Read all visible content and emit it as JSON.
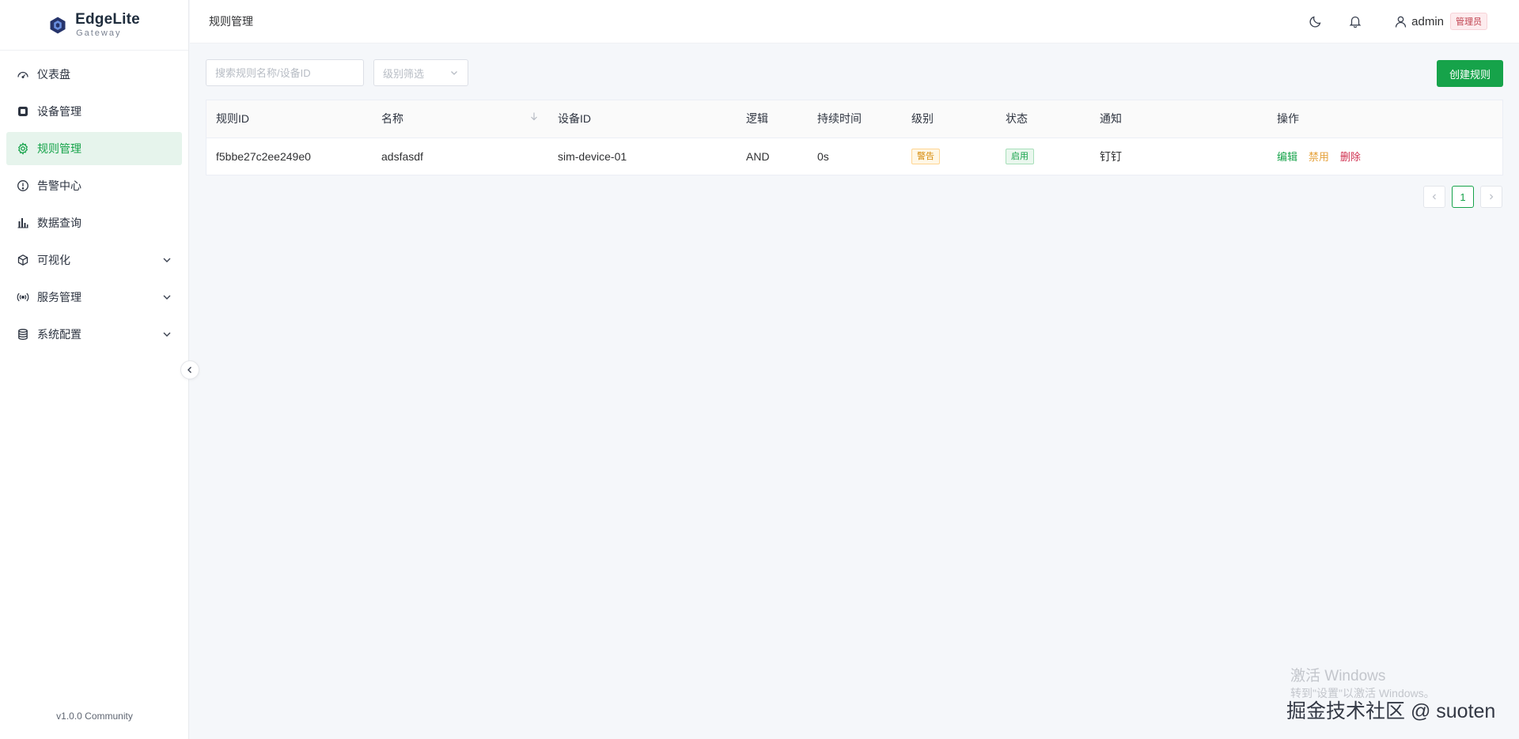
{
  "brand": {
    "name": "EdgeLite",
    "sub": "Gateway"
  },
  "sidebar": {
    "items": [
      {
        "label": "仪表盘",
        "icon": "dashboard-icon"
      },
      {
        "label": "设备管理",
        "icon": "chip-icon"
      },
      {
        "label": "规则管理",
        "icon": "gear-icon",
        "active": true
      },
      {
        "label": "告警中心",
        "icon": "alert-circle-icon"
      },
      {
        "label": "数据查询",
        "icon": "bar-chart-icon"
      },
      {
        "label": "可视化",
        "icon": "cube-icon",
        "expandable": true
      },
      {
        "label": "服务管理",
        "icon": "broadcast-icon",
        "expandable": true
      },
      {
        "label": "系统配置",
        "icon": "database-icon",
        "expandable": true
      }
    ],
    "version": "v1.0.0 Community"
  },
  "header": {
    "title": "规则管理",
    "user": "admin",
    "role": "管理员"
  },
  "toolbar": {
    "search_placeholder": "搜索规则名称/设备ID",
    "level_placeholder": "级别筛选",
    "create_label": "创建规则"
  },
  "table": {
    "columns": [
      "规则ID",
      "名称",
      "设备ID",
      "逻辑",
      "持续时间",
      "级别",
      "状态",
      "通知",
      "操作"
    ],
    "rows": [
      {
        "id": "f5bbe27c2ee249e0",
        "name": "adsfasdf",
        "device": "sim-device-01",
        "logic": "AND",
        "duration": "0s",
        "level": "警告",
        "status": "启用",
        "notify": "钉钉",
        "actions": {
          "edit": "编辑",
          "disable": "禁用",
          "delete": "删除"
        }
      }
    ]
  },
  "pagination": {
    "current": "1"
  },
  "watermark": {
    "line1": "激活 Windows",
    "line2": "转到\"设置\"以激活 Windows。",
    "line3": "掘金技术社区 @ suoten"
  },
  "colors": {
    "accent": "#16a34a",
    "warning": "#d48806",
    "danger": "#d03050"
  }
}
